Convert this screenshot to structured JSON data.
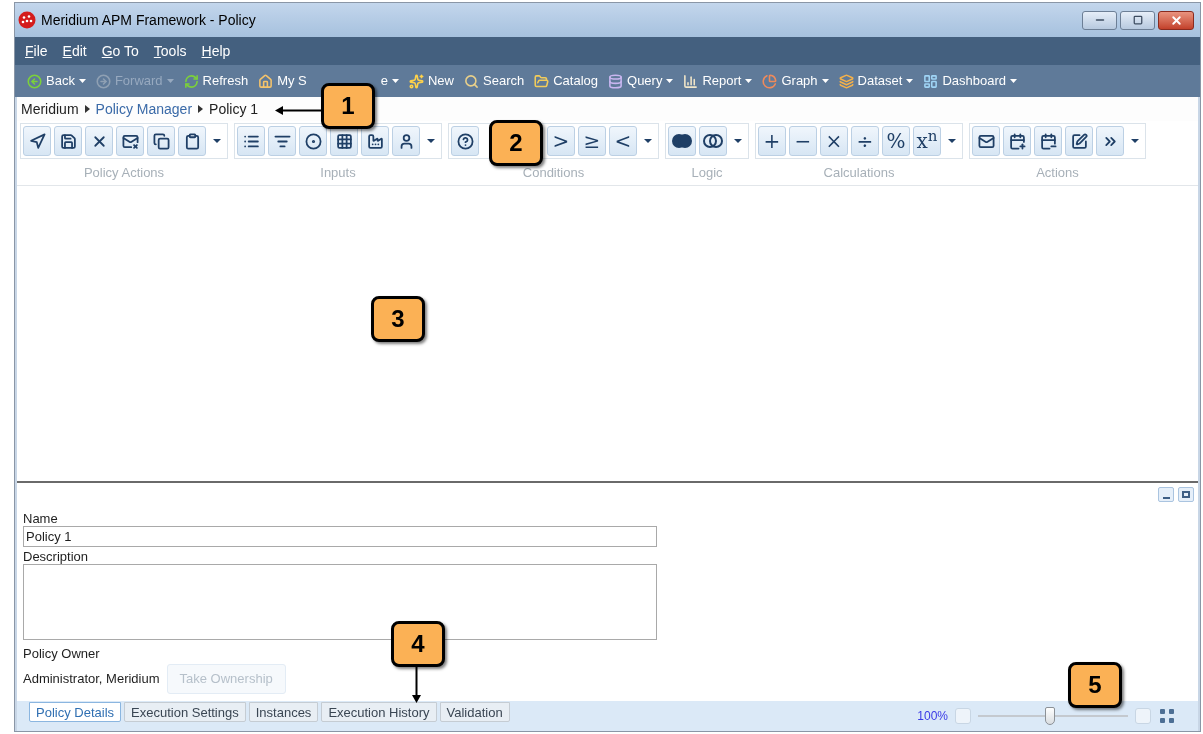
{
  "window": {
    "title": "Meridium APM Framework - Policy"
  },
  "menu": [
    "File",
    "Edit",
    "Go To",
    "Tools",
    "Help"
  ],
  "toolbar": [
    {
      "label": "Back",
      "dropdown": true,
      "disabled": false
    },
    {
      "label": "Forward",
      "dropdown": true,
      "disabled": true
    },
    {
      "label": "Refresh",
      "dropdown": false,
      "disabled": false
    },
    {
      "label": "My S",
      "label_tail": "e",
      "dropdown": true,
      "disabled": false
    },
    {
      "label": "New",
      "dropdown": false,
      "disabled": false
    },
    {
      "label": "Search",
      "dropdown": false,
      "disabled": false
    },
    {
      "label": "Catalog",
      "dropdown": false,
      "disabled": false
    },
    {
      "label": "Query",
      "dropdown": true,
      "disabled": false
    },
    {
      "label": "Report",
      "dropdown": true,
      "disabled": false
    },
    {
      "label": "Graph",
      "dropdown": true,
      "disabled": false
    },
    {
      "label": "Dataset",
      "dropdown": true,
      "disabled": false
    },
    {
      "label": "Dashboard",
      "dropdown": true,
      "disabled": false
    }
  ],
  "breadcrumb": [
    {
      "label": "Meridium",
      "kind": "text"
    },
    {
      "label": "Policy Manager",
      "kind": "link"
    },
    {
      "label": "Policy 1",
      "kind": "text"
    }
  ],
  "ribbon": [
    {
      "label": "Policy Actions",
      "buttons": [
        {
          "kind": "icon"
        },
        {
          "kind": "icon"
        },
        {
          "kind": "icon"
        },
        {
          "kind": "icon"
        },
        {
          "kind": "icon"
        },
        {
          "kind": "icon"
        }
      ]
    },
    {
      "label": "Inputs",
      "buttons": [
        {
          "kind": "icon"
        },
        {
          "kind": "icon"
        },
        {
          "kind": "icon"
        },
        {
          "kind": "icon"
        },
        {
          "kind": "icon"
        },
        {
          "kind": "icon"
        }
      ]
    },
    {
      "label": "Conditions",
      "buttons": [
        {
          "kind": "icon"
        },
        {
          "kind": "gap"
        },
        {
          "kind": "text",
          "text": ">"
        },
        {
          "kind": "text",
          "text": "≥"
        },
        {
          "kind": "text",
          "text": "<"
        }
      ]
    },
    {
      "label": "Logic",
      "buttons": [
        {
          "kind": "icon"
        },
        {
          "kind": "icon"
        }
      ]
    },
    {
      "label": "Calculations",
      "buttons": [
        {
          "kind": "text",
          "text": "+"
        },
        {
          "kind": "text",
          "text": "−"
        },
        {
          "kind": "text",
          "text": "×"
        },
        {
          "kind": "text",
          "text": "÷"
        },
        {
          "kind": "text",
          "text": "%"
        },
        {
          "kind": "text",
          "text": "x$^{n}$"
        }
      ]
    },
    {
      "label": "Actions",
      "buttons": [
        {
          "kind": "icon"
        },
        {
          "kind": "icon"
        },
        {
          "kind": "icon"
        },
        {
          "kind": "icon"
        },
        {
          "kind": "icon"
        }
      ]
    }
  ],
  "details": {
    "name_label": "Name",
    "name_value": "Policy 1",
    "description_label": "Description",
    "owner_label": "Policy Owner",
    "owner_value": "Administrator, Meridium",
    "take_ownership": {
      "label": "Take Ownership",
      "disabled": true
    }
  },
  "tabs": [
    {
      "label": "Policy Details",
      "selected": true
    },
    {
      "label": "Execution Settings",
      "selected": false
    },
    {
      "label": "Instances",
      "selected": false
    },
    {
      "label": "Execution History",
      "selected": false
    },
    {
      "label": "Validation",
      "selected": false
    }
  ],
  "zoom": {
    "reading": "100%",
    "level": 0.48
  },
  "callouts": [
    "1",
    "2",
    "3",
    "4",
    "5"
  ]
}
